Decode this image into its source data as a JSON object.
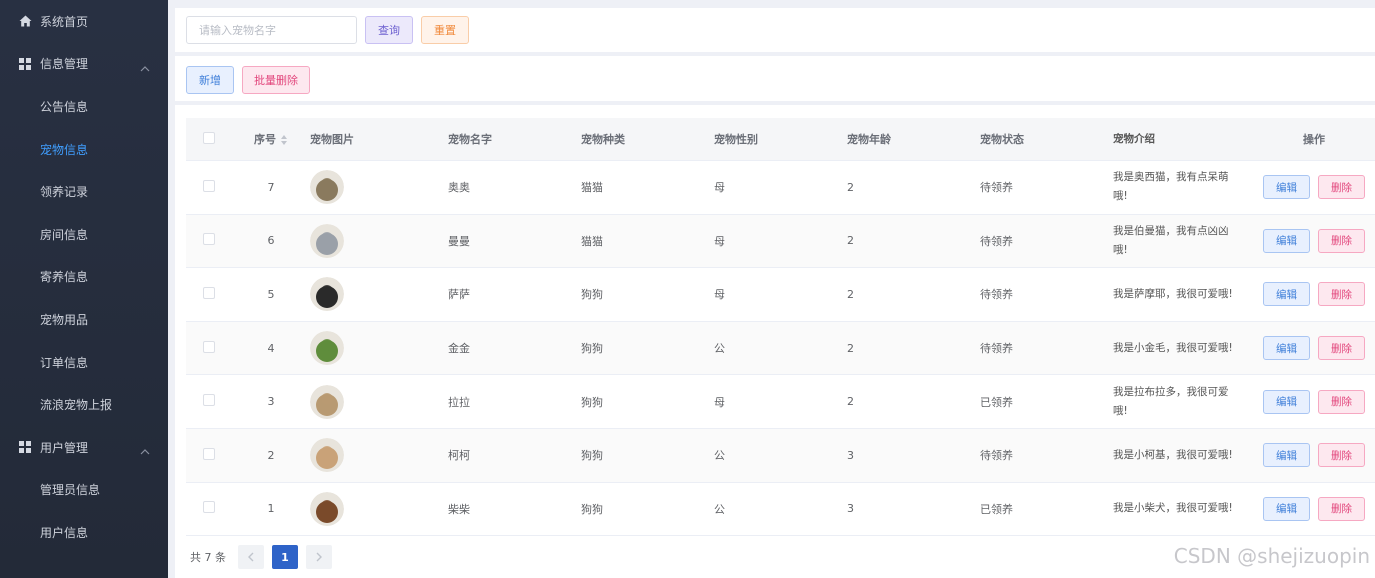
{
  "sidebar": {
    "items": [
      {
        "label": "系统首页",
        "icon": "home-icon",
        "level": "top"
      },
      {
        "label": "信息管理",
        "icon": "grid-icon",
        "level": "top",
        "expanded": true
      },
      {
        "label": "公告信息",
        "level": "sub"
      },
      {
        "label": "宠物信息",
        "level": "sub",
        "active": true
      },
      {
        "label": "领养记录",
        "level": "sub"
      },
      {
        "label": "房间信息",
        "level": "sub"
      },
      {
        "label": "寄养信息",
        "level": "sub"
      },
      {
        "label": "宠物用品",
        "level": "sub"
      },
      {
        "label": "订单信息",
        "level": "sub"
      },
      {
        "label": "流浪宠物上报",
        "level": "sub"
      },
      {
        "label": "用户管理",
        "icon": "grid-icon",
        "level": "top",
        "expanded": true
      },
      {
        "label": "管理员信息",
        "level": "sub"
      },
      {
        "label": "用户信息",
        "level": "sub"
      }
    ]
  },
  "search": {
    "placeholder": "请输入宠物名字",
    "value": "",
    "query_label": "查询",
    "reset_label": "重置"
  },
  "actions": {
    "add_label": "新增",
    "batch_delete_label": "批量删除"
  },
  "table": {
    "headers": {
      "no": "序号",
      "img": "宠物图片",
      "name": "宠物名字",
      "kind": "宠物种类",
      "sex": "宠物性别",
      "age": "宠物年龄",
      "status": "宠物状态",
      "intro": "宠物介绍",
      "ops": "操作"
    },
    "edit_label": "编辑",
    "delete_label": "删除",
    "rows": [
      {
        "no": "7",
        "name": "奥奥",
        "kind": "猫猫",
        "sex": "母",
        "age": "2",
        "status": "待领养",
        "intro": "我是奥西猫，我有点呆萌哦!",
        "avatar": "#8a7a5e"
      },
      {
        "no": "6",
        "name": "曼曼",
        "kind": "猫猫",
        "sex": "母",
        "age": "2",
        "status": "待领养",
        "intro": "我是伯曼猫，我有点凶凶哦!",
        "avatar": "#9aa0a8"
      },
      {
        "no": "5",
        "name": "萨萨",
        "kind": "狗狗",
        "sex": "母",
        "age": "2",
        "status": "待领养",
        "intro": "我是萨摩耶，我很可爱哦!",
        "avatar": "#2a2a2a"
      },
      {
        "no": "4",
        "name": "金金",
        "kind": "狗狗",
        "sex": "公",
        "age": "2",
        "status": "待领养",
        "intro": "我是小金毛，我很可爱哦!",
        "avatar": "#5f8d3c"
      },
      {
        "no": "3",
        "name": "拉拉",
        "kind": "狗狗",
        "sex": "母",
        "age": "2",
        "status": "已领养",
        "intro": "我是拉布拉多，我很可爱哦!",
        "avatar": "#b89a72"
      },
      {
        "no": "2",
        "name": "柯柯",
        "kind": "狗狗",
        "sex": "公",
        "age": "3",
        "status": "待领养",
        "intro": "我是小柯基，我很可爱哦!",
        "avatar": "#c9a278"
      },
      {
        "no": "1",
        "name": "柴柴",
        "kind": "狗狗",
        "sex": "公",
        "age": "3",
        "status": "已领养",
        "intro": "我是小柴犬，我很可爱哦!",
        "avatar": "#7a4a2a"
      }
    ]
  },
  "pagination": {
    "total_label": "共 7 条",
    "current_page": "1"
  },
  "watermark": "CSDN @shejizuopin",
  "colors": {
    "sidebar_bg": "#252c3b",
    "active": "#409eff",
    "page_active": "#2e63c8"
  }
}
